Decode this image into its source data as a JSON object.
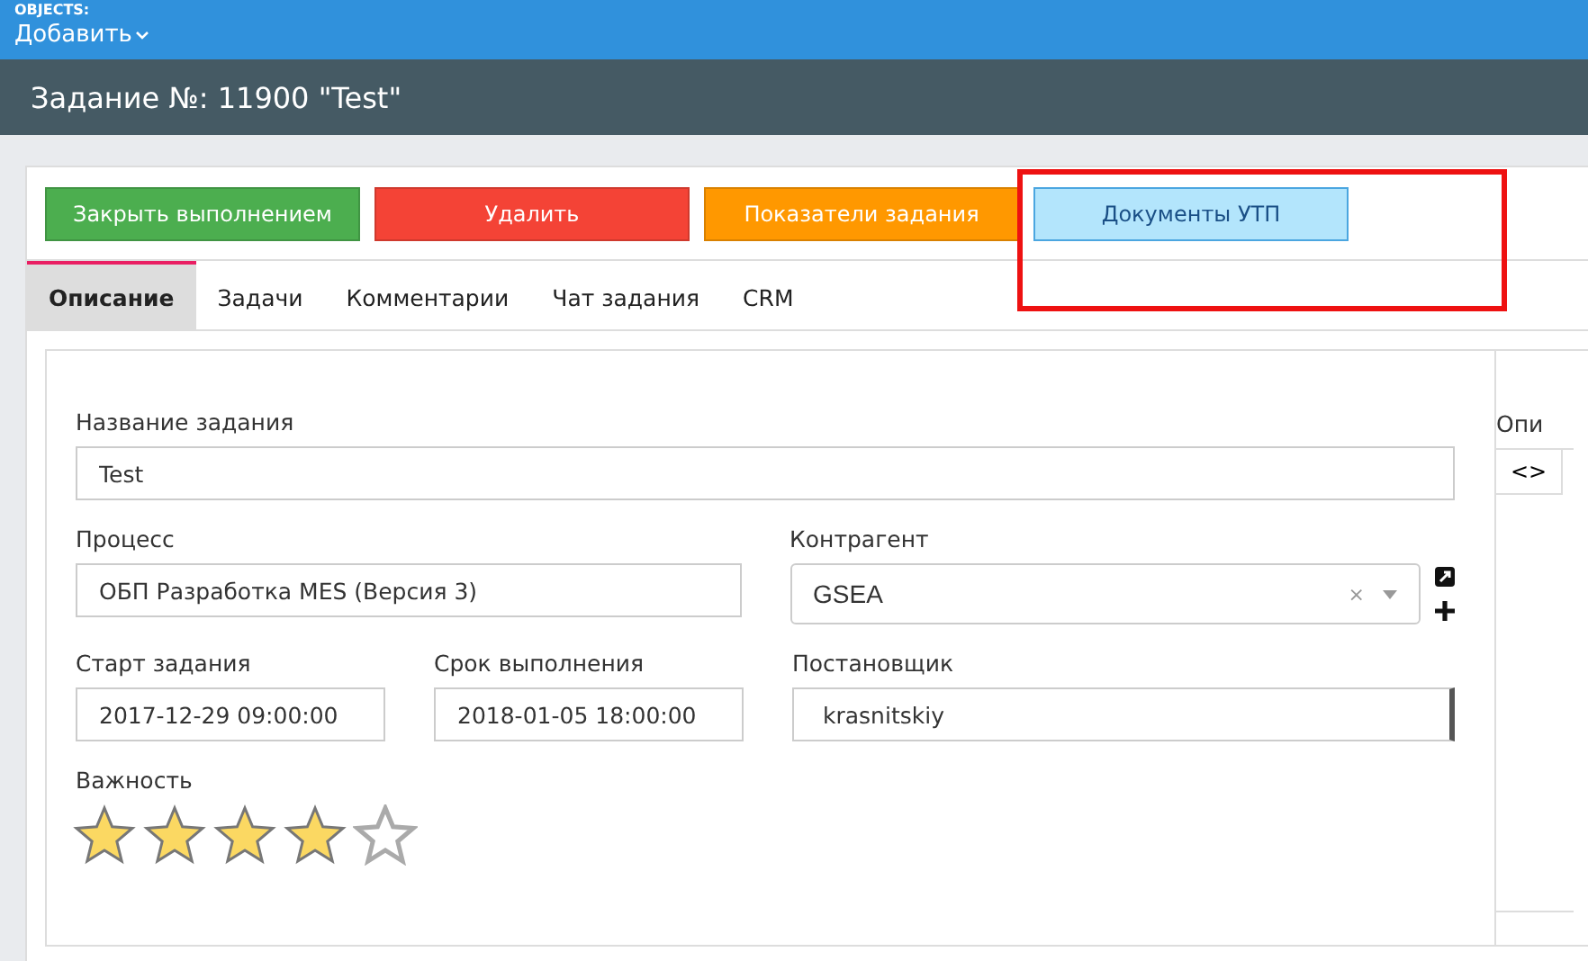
{
  "top_bar": {
    "label": "OBJECTS:",
    "menu": "Добавить"
  },
  "title": "Задание №: 11900 \"Test\"",
  "buttons": [
    {
      "label": "Закрыть выполнением",
      "kind": "success"
    },
    {
      "label": "Удалить",
      "kind": "danger"
    },
    {
      "label": "Показатели задания",
      "kind": "warning"
    },
    {
      "label": "Документы УТП",
      "kind": "info",
      "highlighted": true
    }
  ],
  "tabs": [
    {
      "label": "Описание",
      "selected": true
    },
    {
      "label": "Задачи",
      "selected": false
    },
    {
      "label": "Комментарии",
      "selected": false
    },
    {
      "label": "Чат задания",
      "selected": false
    },
    {
      "label": "CRM",
      "selected": false
    }
  ],
  "form": {
    "name": {
      "label": "Название задания",
      "value": "Test"
    },
    "process": {
      "label": "Процесс",
      "value": "ОБП Разработка MES (Версия 3)"
    },
    "counterparty": {
      "label": "Контрагент",
      "value": "GSEA",
      "clear": "×"
    },
    "start": {
      "label": "Старт задания",
      "value": "2017-12-29 09:00:00"
    },
    "deadline": {
      "label": "Срок выполнения",
      "value": "2018-01-05 18:00:00"
    },
    "author": {
      "label": "Постановщик",
      "value": "krasnitskiy"
    },
    "importance": {
      "label": "Важность",
      "stars": 4
    }
  },
  "side_panel": {
    "label": "Опи",
    "toolbar_button": "<>"
  }
}
